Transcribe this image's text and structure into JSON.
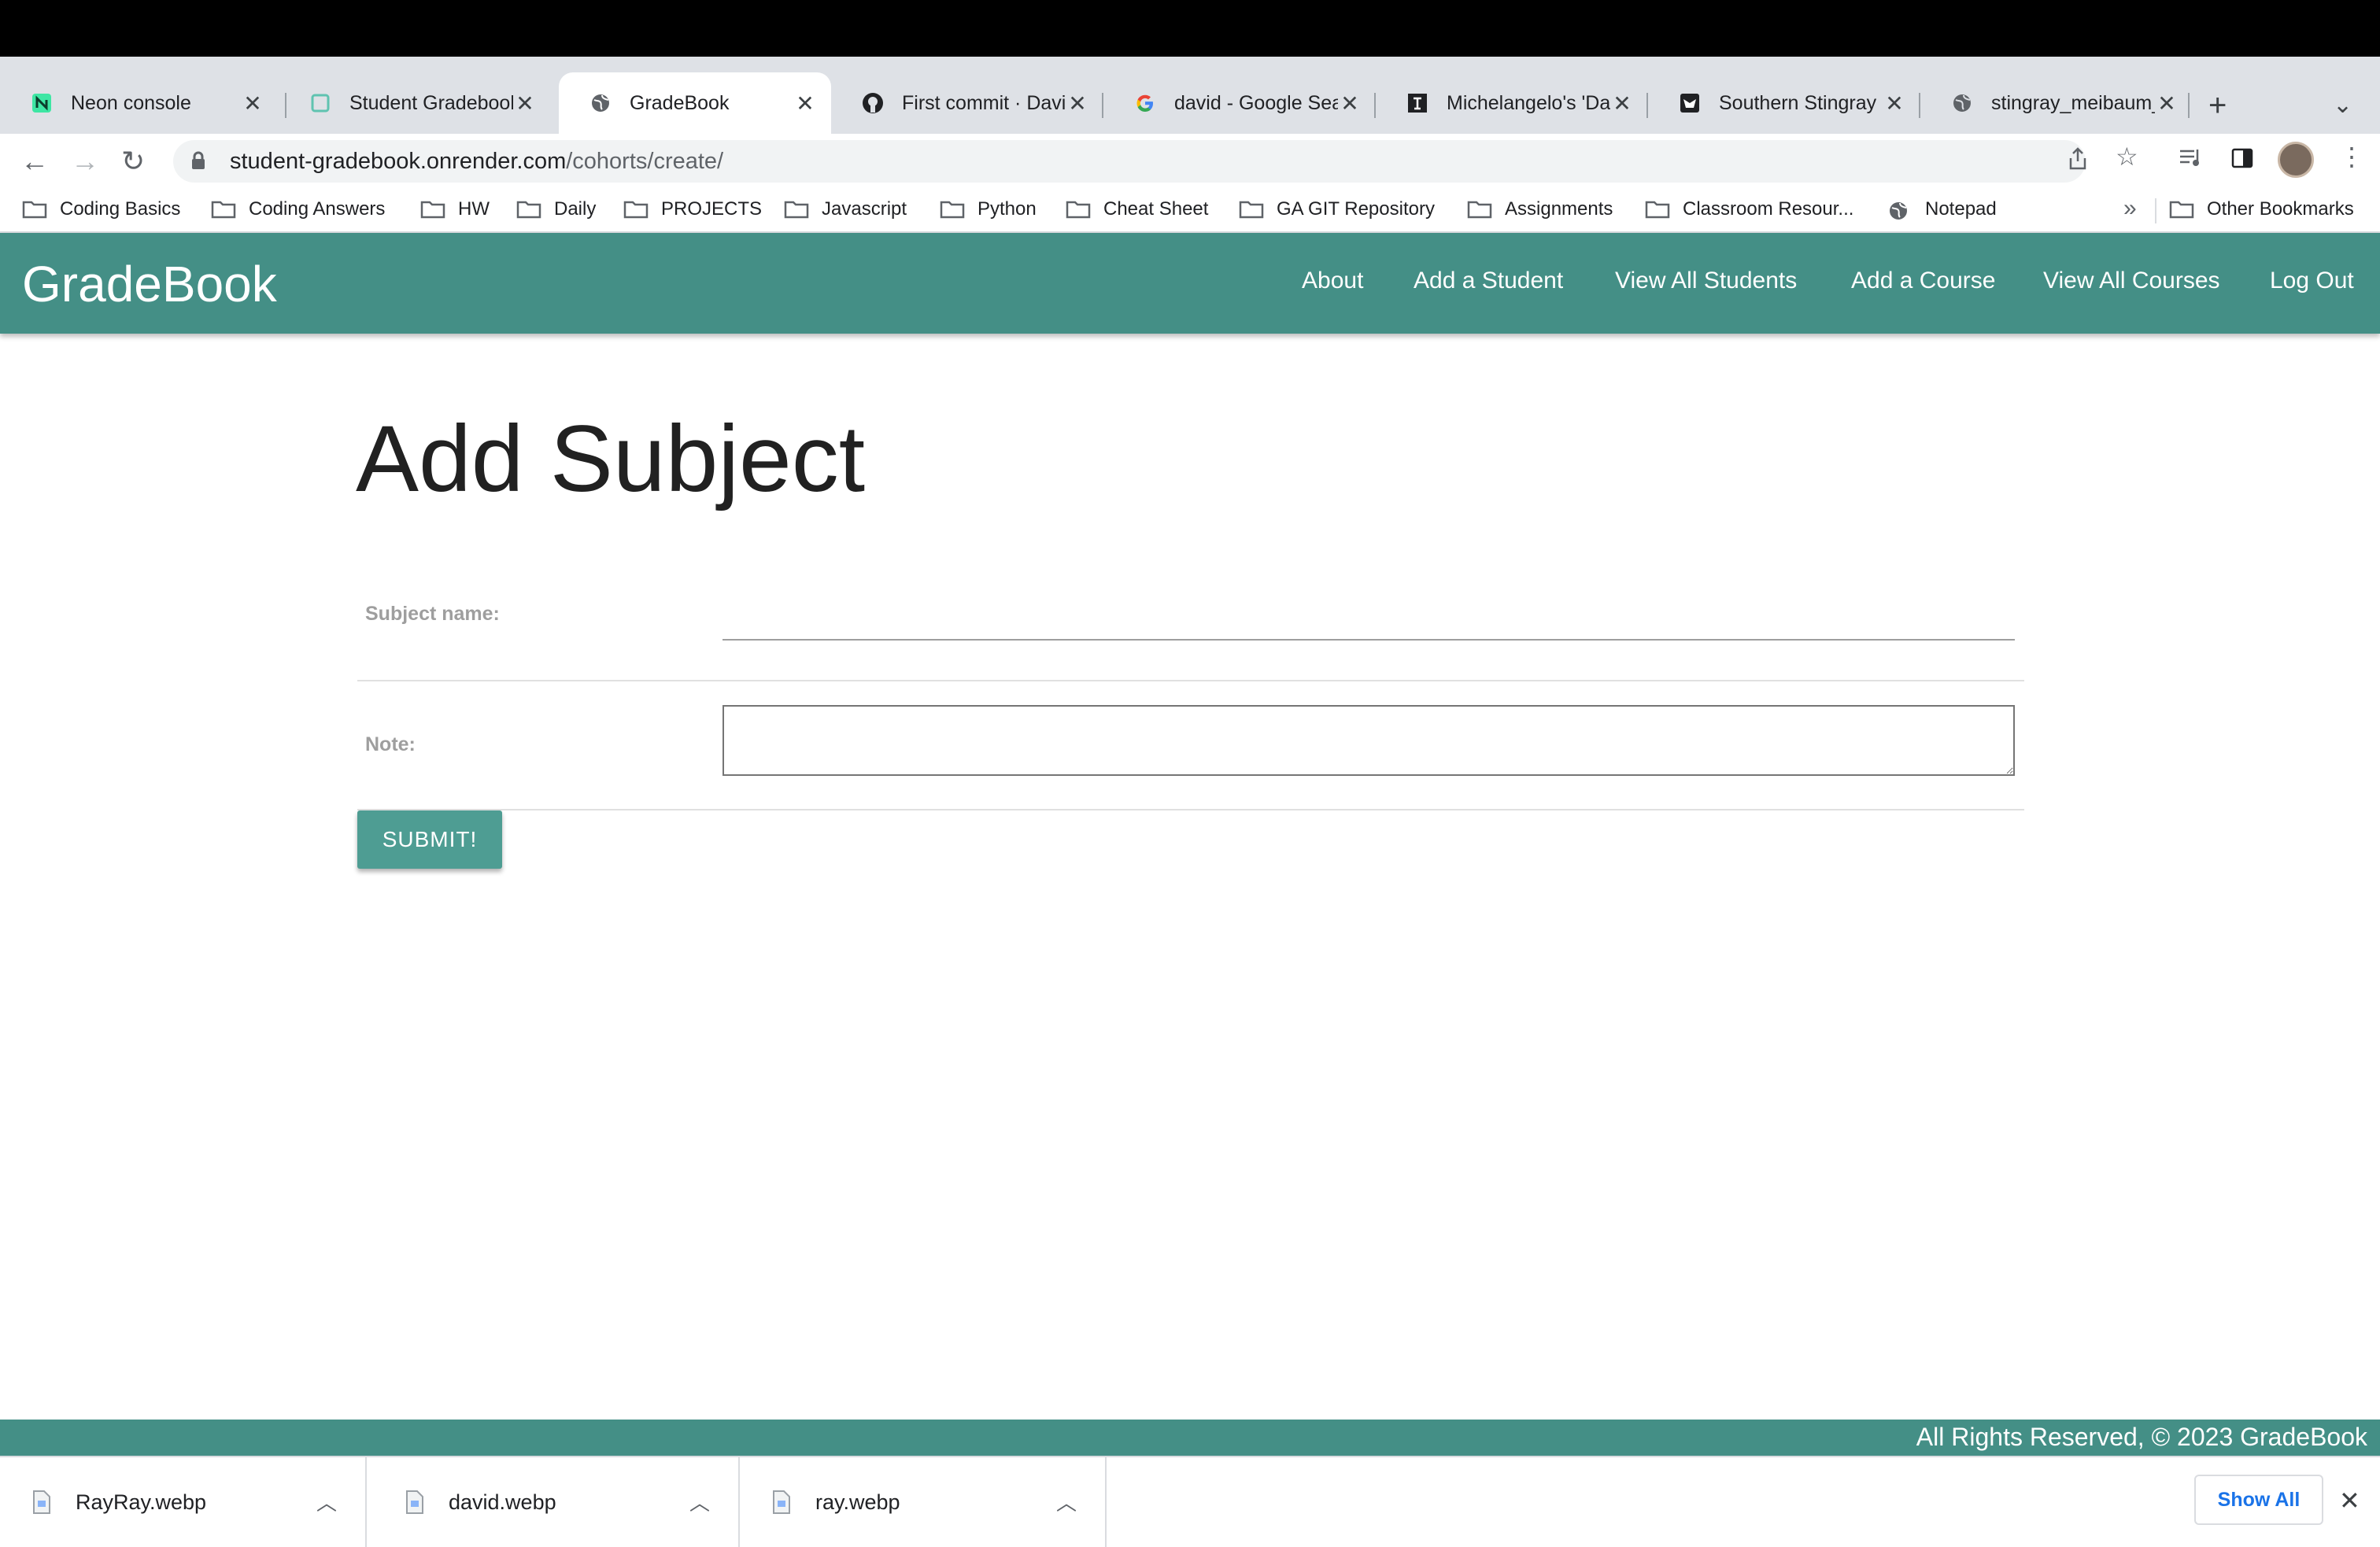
{
  "browser": {
    "tabs": [
      {
        "label": "Neon console",
        "icon": "neon-icon",
        "active": false
      },
      {
        "label": "Student Gradebook",
        "icon": "page-icon",
        "active": false
      },
      {
        "label": "GradeBook",
        "icon": "globe-icon",
        "active": true
      },
      {
        "label": "First commit · Davi",
        "icon": "github-icon",
        "active": false
      },
      {
        "label": "david - Google Sea",
        "icon": "google-icon",
        "active": false
      },
      {
        "label": "Michelangelo's 'Da",
        "icon": "smithsonian-icon",
        "active": false
      },
      {
        "label": "Southern Stingray",
        "icon": "wildlife-icon",
        "active": false
      },
      {
        "label": "stingray_meibaum_",
        "icon": "globe-icon",
        "active": false
      }
    ],
    "new_tab_symbol": "+",
    "tab_menu_symbol": "⌄",
    "close_symbol": "✕",
    "address": {
      "host": "student-gradebook.onrender.com",
      "path": "/cohorts/create/"
    },
    "bookmarks": [
      {
        "label": "Coding Basics",
        "icon": "folder-icon"
      },
      {
        "label": "Coding Answers",
        "icon": "folder-icon"
      },
      {
        "label": "HW",
        "icon": "folder-icon"
      },
      {
        "label": "Daily",
        "icon": "folder-icon"
      },
      {
        "label": "PROJECTS",
        "icon": "folder-icon"
      },
      {
        "label": "Javascript",
        "icon": "folder-icon"
      },
      {
        "label": "Python",
        "icon": "folder-icon"
      },
      {
        "label": "Cheat Sheet",
        "icon": "folder-icon"
      },
      {
        "label": "GA GIT Repository",
        "icon": "folder-icon"
      },
      {
        "label": "Assignments",
        "icon": "folder-icon"
      },
      {
        "label": "Classroom Resour...",
        "icon": "folder-icon"
      },
      {
        "label": "Notepad",
        "icon": "globe-icon"
      }
    ],
    "bookmarks_overflow": "»",
    "other_bookmarks": "Other Bookmarks"
  },
  "app": {
    "brand": "GradeBook",
    "nav": [
      "About",
      "Add a Student",
      "View All Students",
      "Add a Course",
      "View All Courses",
      "Log Out"
    ],
    "accent_color": "#448f86"
  },
  "form": {
    "title": "Add Subject",
    "subject_label": "Subject name:",
    "subject_value": "",
    "note_label": "Note:",
    "note_value": "",
    "submit_label": "SUBMIT!"
  },
  "footer": {
    "text": "All Rights Reserved, © 2023 GradeBook"
  },
  "downloads": {
    "items": [
      "RayRay.webp",
      "david.webp",
      "ray.webp"
    ],
    "show_all": "Show All",
    "close": "✕"
  }
}
